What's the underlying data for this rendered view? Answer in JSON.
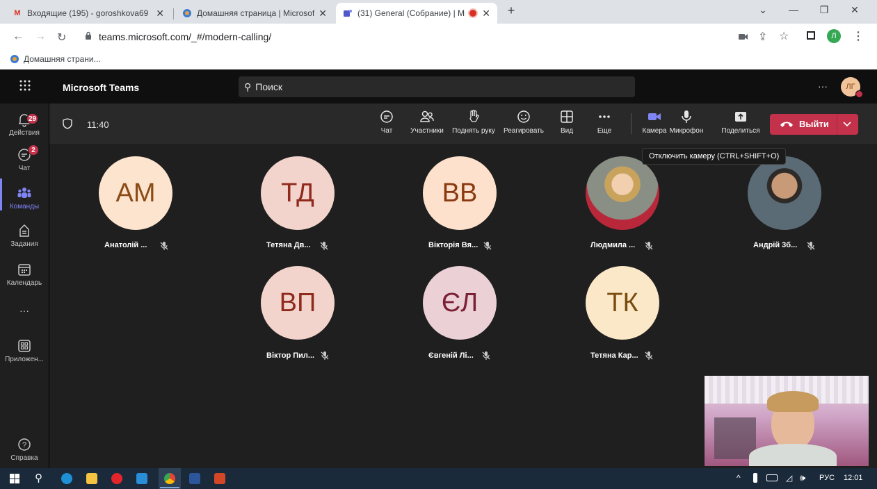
{
  "browser": {
    "tabs": [
      {
        "title": "Входящие (195) - goroshkova69",
        "active": false
      },
      {
        "title": "Домашняя страница | Microsoft",
        "active": false
      },
      {
        "title": "(31) General (Собрание) | Mi",
        "active": true
      }
    ],
    "new_tab": "+",
    "url": "teams.microsoft.com/_#/modern-calling/",
    "bookmark": "Домашняя страни...",
    "profile_initial": "Л"
  },
  "teams": {
    "app_name": "Microsoft Teams",
    "search_placeholder": "Поиск",
    "more": "···",
    "user_initials": "ЛГ",
    "rail": [
      {
        "label": "Действия",
        "icon": "bell-icon",
        "badge": "29"
      },
      {
        "label": "Чат",
        "icon": "chat-icon",
        "badge": "2"
      },
      {
        "label": "Команды",
        "icon": "teams-icon",
        "badge": ""
      },
      {
        "label": "Задания",
        "icon": "assignments-icon",
        "badge": ""
      },
      {
        "label": "Календарь",
        "icon": "calendar-icon",
        "badge": ""
      },
      {
        "label": "···",
        "icon": "more-icon",
        "badge": ""
      },
      {
        "label": "Приложен...",
        "icon": "apps-icon",
        "badge": ""
      },
      {
        "label": "Справка",
        "icon": "help-icon",
        "badge": ""
      }
    ]
  },
  "call": {
    "timer": "11:40",
    "controls": [
      "Чат",
      "Участники",
      "Поднять руку",
      "Реагировать",
      "Вид",
      "Еще",
      "Камера",
      "Микрофон",
      "Поделиться"
    ],
    "leave_label": "Выйти",
    "tooltip": "Отключить камеру (CTRL+SHIFT+O)",
    "participants": [
      {
        "initials": "АМ",
        "name": "Анатолій ...",
        "bg": "#fce4cf",
        "fg": "#8a4b16"
      },
      {
        "initials": "ТД",
        "name": "Тетяна Дв...",
        "bg": "#f3d4cd",
        "fg": "#8f2a1c"
      },
      {
        "initials": "ВВ",
        "name": "Вікторія Вя...",
        "bg": "#fde1cc",
        "fg": "#8a3a10"
      },
      {
        "initials": "",
        "name": "Людмила ...",
        "bg": "#6a5a5a",
        "fg": "#fff"
      },
      {
        "initials": "",
        "name": "Андрій 3б...",
        "bg": "#5b4a3c",
        "fg": "#fff"
      },
      {
        "initials": "ВП",
        "name": "Віктор Пил...",
        "bg": "#f3d4cd",
        "fg": "#8f2a1c"
      },
      {
        "initials": "ЄЛ",
        "name": "Євгеній Лі...",
        "bg": "#ebd0d6",
        "fg": "#7a2134"
      },
      {
        "initials": "ТК",
        "name": "Тетяна Кар...",
        "bg": "#fbe8c8",
        "fg": "#7a4d0f"
      }
    ]
  },
  "taskbar": {
    "tray": "^",
    "lang": "РУС",
    "time": "12:01"
  },
  "colors": {
    "accent": "#7f85f5",
    "leave": "#c4314b",
    "camera": "#6264a7"
  }
}
